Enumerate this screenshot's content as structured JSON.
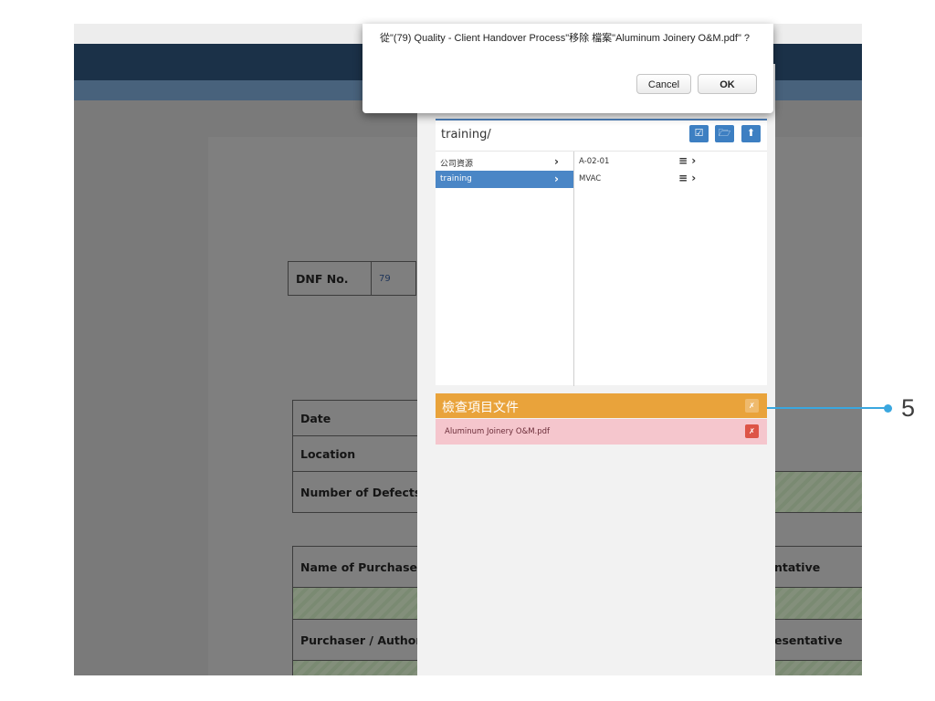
{
  "dialog": {
    "message": "從\"(79) Quality - Client Handover Process\"移除 檔案\"Aluminum Joinery O&M.pdf\" ?",
    "cancel_label": "Cancel",
    "ok_label": "OK"
  },
  "document": {
    "dnf_label": "DNF No.",
    "dnf_value": "79",
    "date_label": "Date",
    "location_label": "Location",
    "defects_label": "Number of Defects",
    "purchaser_name_label": "Name of Purchaser /",
    "representative_label": "ntative",
    "purchaser_sign_label": "Purchaser / Authori",
    "representative2_label": "esentative"
  },
  "picker": {
    "path": "training/",
    "toolbar_icons": [
      "check-square-icon",
      "folder-open-icon",
      "upload-icon"
    ],
    "left_items": [
      {
        "label": "公司資源",
        "selected": false
      },
      {
        "label": "training",
        "selected": true
      }
    ],
    "right_items": [
      {
        "label": "A-02-01"
      },
      {
        "label": "MVAC"
      }
    ]
  },
  "inspection": {
    "title": "檢查項目文件",
    "files": [
      {
        "name": "Aluminum Joinery O&M.pdf"
      }
    ]
  },
  "callout": {
    "number": "5",
    "color": "#3aa7df"
  },
  "colors": {
    "nav_dark": "#1b3148",
    "accent_blue": "#4a86c6",
    "header_orange": "#e9a33b",
    "file_row_pink": "#f5c6cd",
    "delete_red": "#dd5447"
  }
}
